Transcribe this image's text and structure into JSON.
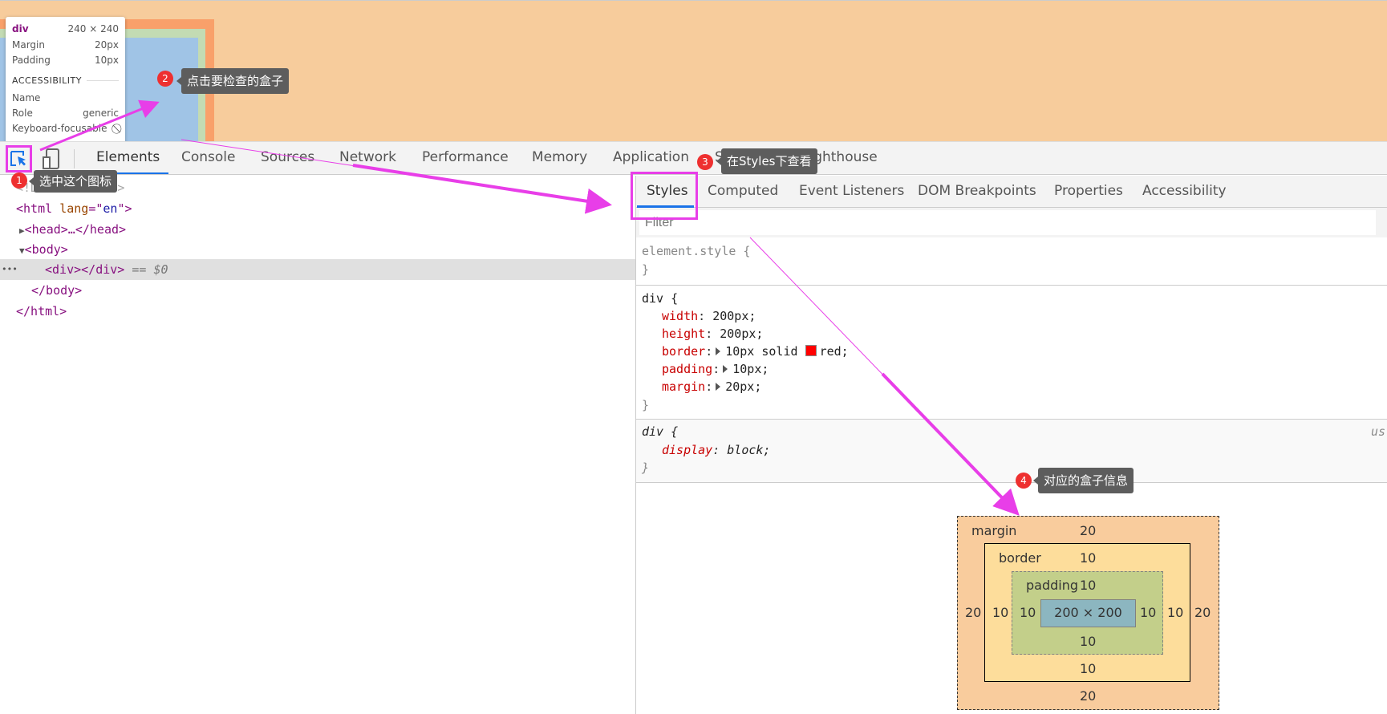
{
  "page_overlay": {
    "tooltip": {
      "tag": "div",
      "size": "240 × 240",
      "rows": [
        {
          "label": "Margin",
          "value": "20px"
        },
        {
          "label": "Padding",
          "value": "10px"
        }
      ],
      "accessibility_heading": "ACCESSIBILITY",
      "acc_rows": [
        {
          "label": "Name",
          "value": ""
        },
        {
          "label": "Role",
          "value": "generic"
        },
        {
          "label": "Keyboard-focusable",
          "value": "⃠"
        }
      ]
    }
  },
  "toolbar": {
    "tabs": [
      "Elements",
      "Console",
      "Sources",
      "Network",
      "Performance",
      "Memory",
      "Application",
      "Security",
      "Lighthouse"
    ],
    "active_tab": "Elements"
  },
  "dom_tree": {
    "doctype": "<!DOCTYPE html>",
    "html_open": {
      "tag": "html",
      "attr": "lang",
      "value": "en"
    },
    "head": "<head>…</head>",
    "body_open": "<body>",
    "selected": "<div></div>",
    "selected_suffix": "== $0",
    "ellipsis": "•••",
    "body_close": "</body>",
    "html_close": "</html>"
  },
  "styles_panel": {
    "tabs": [
      "Styles",
      "Computed",
      "Event Listeners",
      "DOM Breakpoints",
      "Properties",
      "Accessibility"
    ],
    "active_tab": "Styles",
    "filter_placeholder": "Filter",
    "element_style": "element.style {",
    "rule1": {
      "selector": "div {",
      "props": [
        {
          "name": "width",
          "value": "200px;"
        },
        {
          "name": "height",
          "value": "200px;"
        },
        {
          "name": "border",
          "value": "10px solid",
          "color_value": "red;",
          "swatch": "#ff0000"
        },
        {
          "name": "padding",
          "value": "10px;"
        },
        {
          "name": "margin",
          "value": "20px;"
        }
      ]
    },
    "rule2": {
      "selector": "div {",
      "source": "us",
      "props": [
        {
          "name": "display",
          "value": "block;"
        }
      ]
    },
    "close_brace": "}"
  },
  "box_model": {
    "margin_label": "margin",
    "margin": {
      "top": "20",
      "right": "20",
      "bottom": "20",
      "left": "20"
    },
    "border_label": "border",
    "border": {
      "top": "10",
      "right": "10",
      "bottom": "10",
      "left": "10"
    },
    "padding_label": "padding",
    "padding": {
      "top": "10",
      "right": "10",
      "bottom": "10",
      "left": "10"
    },
    "content": "200 × 200",
    "colors": {
      "margin": "#f9cc9d",
      "border": "#fddd9b",
      "padding": "#c3cf8a",
      "content": "#8cb6c0"
    }
  },
  "annotations": [
    {
      "num": "1",
      "text": "选中这个图标"
    },
    {
      "num": "2",
      "text": "点击要检查的盒子"
    },
    {
      "num": "3",
      "text": "在Styles下查看"
    },
    {
      "num": "4",
      "text": "对应的盒子信息"
    }
  ],
  "colors": {
    "accent": "#1a73e8",
    "annotation": "#e83ee8",
    "badge": "#ee3030"
  }
}
